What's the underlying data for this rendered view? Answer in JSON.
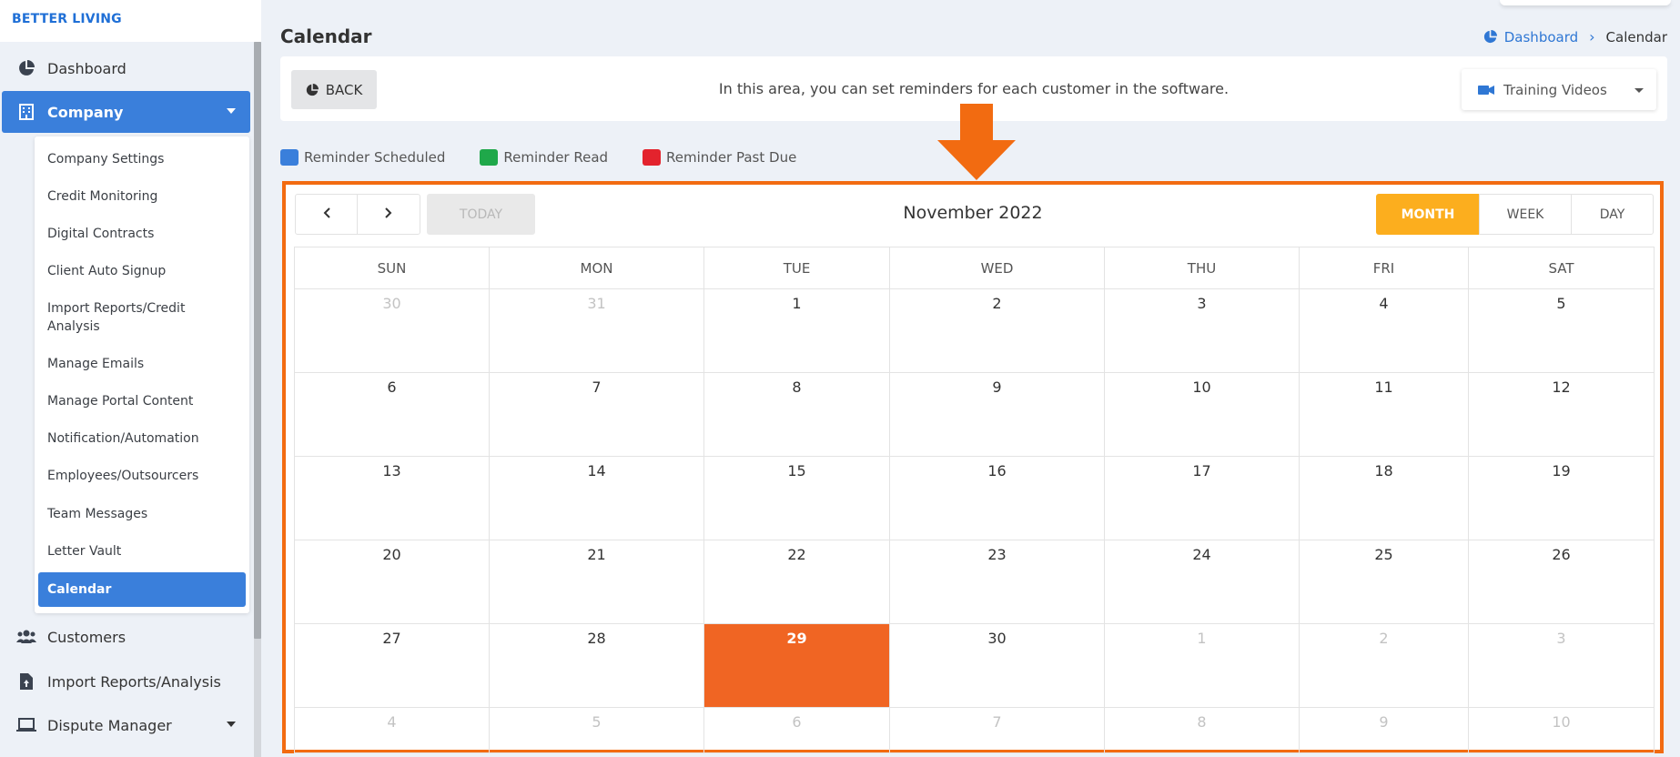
{
  "brand": "BETTER LIVING",
  "sidebar": {
    "items": [
      {
        "label": "Dashboard",
        "icon": "pie-chart-icon"
      },
      {
        "label": "Company",
        "icon": "building-icon"
      },
      {
        "label": "Customers",
        "icon": "users-icon"
      },
      {
        "label": "Import Reports/Analysis",
        "icon": "file-upload-icon"
      },
      {
        "label": "Dispute Manager",
        "icon": "laptop-icon"
      }
    ],
    "submenu": [
      "Company Settings",
      "Credit Monitoring",
      "Digital Contracts",
      "Client Auto Signup",
      "Import Reports/Credit Analysis",
      "Manage Emails",
      "Manage Portal Content",
      "Notification/Automation",
      "Employees/Outsourcers",
      "Team Messages",
      "Letter Vault",
      "Calendar"
    ]
  },
  "header": {
    "title": "Calendar",
    "breadcrumb": {
      "home": "Dashboard",
      "current": "Calendar"
    }
  },
  "infobar": {
    "back_label": "BACK",
    "text": "In this area, you can set reminders for each customer in the software.",
    "training_label": "Training Videos"
  },
  "legend": [
    {
      "label": "Reminder Scheduled",
      "color": "#3a7fdb"
    },
    {
      "label": "Reminder Read",
      "color": "#1fa84a"
    },
    {
      "label": "Reminder Past Due",
      "color": "#e3232d"
    }
  ],
  "calendar": {
    "title": "November 2022",
    "today_label": "TODAY",
    "views": [
      "MONTH",
      "WEEK",
      "DAY"
    ],
    "active_view": "MONTH",
    "weekdays": [
      "SUN",
      "MON",
      "TUE",
      "WED",
      "THU",
      "FRI",
      "SAT"
    ],
    "weeks": [
      [
        "30",
        "31",
        "1",
        "2",
        "3",
        "4",
        "5"
      ],
      [
        "6",
        "7",
        "8",
        "9",
        "10",
        "11",
        "12"
      ],
      [
        "13",
        "14",
        "15",
        "16",
        "17",
        "18",
        "19"
      ],
      [
        "20",
        "21",
        "22",
        "23",
        "24",
        "25",
        "26"
      ],
      [
        "27",
        "28",
        "29",
        "30",
        "1",
        "2",
        "3"
      ],
      [
        "4",
        "5",
        "6",
        "7",
        "8",
        "9",
        "10"
      ]
    ],
    "today": "29"
  },
  "colors": {
    "accent": "#3a7fdb",
    "highlight": "#f26b11",
    "today": "#f06523",
    "month_button": "#fcae1e"
  }
}
